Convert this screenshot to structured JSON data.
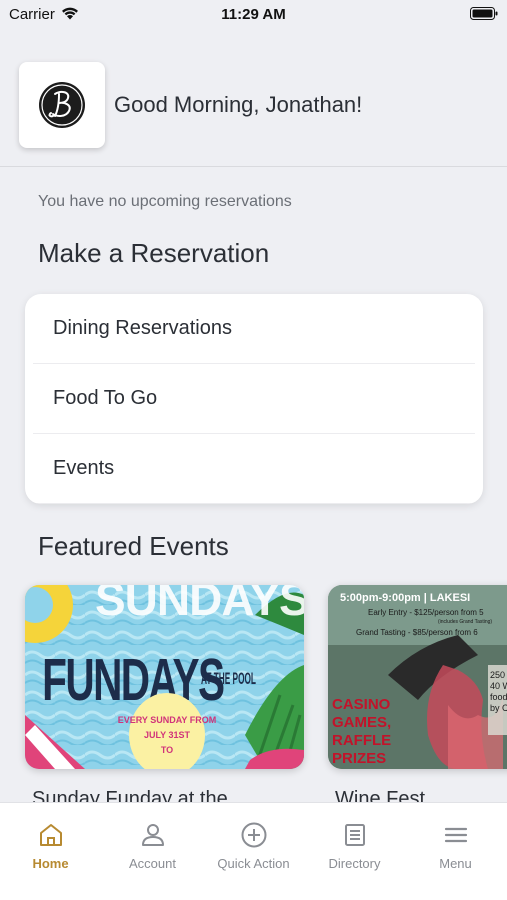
{
  "status_bar": {
    "carrier": "Carrier",
    "time": "11:29 AM"
  },
  "header": {
    "greeting": "Good Morning, Jonathan!"
  },
  "reservations": {
    "empty_message": "You have no upcoming reservations",
    "title": "Make a Reservation",
    "items": [
      {
        "label": "Dining Reservations"
      },
      {
        "label": "Food To Go"
      },
      {
        "label": "Events"
      }
    ]
  },
  "featured": {
    "title": "Featured Events",
    "events": [
      {
        "title": "Sunday Funday at the",
        "poster_lines": [
          "SUNDAYS",
          "FUNDAYS",
          "AT THE POOL",
          "EVERY SUNDAY FROM",
          "JULY 31ST",
          "TO"
        ]
      },
      {
        "title": "Wine Fest",
        "poster_lines": [
          "5:00pm-9:00pm | LAKESI",
          "Early Entry - $125/person from 5",
          "(includes Grand Tasting)",
          "Grand Tasting - $85/person from 6",
          "CASINO",
          "GAMES,",
          "RAFFLE",
          "PRIZES",
          "250",
          "40 W",
          "food",
          "by C"
        ]
      }
    ]
  },
  "tab_bar": {
    "tabs": [
      {
        "label": "Home",
        "icon": "home-icon",
        "active": true
      },
      {
        "label": "Account",
        "icon": "account-icon",
        "active": false
      },
      {
        "label": "Quick Action",
        "icon": "plus-circle-icon",
        "active": false
      },
      {
        "label": "Directory",
        "icon": "directory-icon",
        "active": false
      },
      {
        "label": "Menu",
        "icon": "menu-icon",
        "active": false
      }
    ]
  },
  "colors": {
    "accent": "#b78a31",
    "background": "#eeeff3",
    "inactive_tab": "#8a8d93"
  }
}
